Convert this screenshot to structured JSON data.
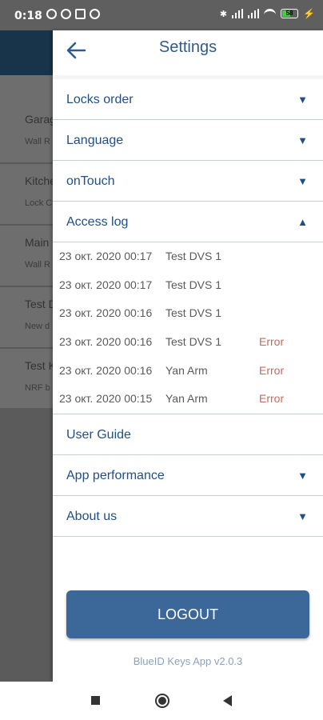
{
  "status_bar": {
    "time": "0:18",
    "battery_level": "58"
  },
  "background_app": {
    "items": [
      {
        "title": "Garage",
        "subtitle": "Wall R"
      },
      {
        "title": "Kitchen",
        "subtitle": "Lock C"
      },
      {
        "title": "Main",
        "subtitle": "Wall R"
      },
      {
        "title": "Test D",
        "subtitle": "New d"
      },
      {
        "title": "Test K",
        "subtitle": "NRF b"
      }
    ]
  },
  "drawer": {
    "title": "Settings",
    "menu": {
      "locks_order": "Locks order",
      "language": "Language",
      "on_touch": "onTouch",
      "access_log": "Access log",
      "user_guide": "User Guide",
      "app_performance": "App performance",
      "about_us": "About us"
    },
    "arrows": {
      "down": "▼",
      "up": "▲"
    },
    "access_log": [
      {
        "date": "23 окт. 2020 00:17",
        "device": "Test DVS 1",
        "status": ""
      },
      {
        "date": "23 окт. 2020 00:17",
        "device": "Test DVS 1",
        "status": ""
      },
      {
        "date": "23 окт. 2020 00:16",
        "device": "Test DVS 1",
        "status": ""
      },
      {
        "date": "23 окт. 2020 00:16",
        "device": "Test DVS 1",
        "status": "Error"
      },
      {
        "date": "23 окт. 2020 00:16",
        "device": "Yan Arm",
        "status": "Error"
      },
      {
        "date": "23 окт. 2020 00:15",
        "device": "Yan Arm",
        "status": "Error"
      }
    ],
    "logout_label": "LOGOUT",
    "version": "BlueID Keys App v2.0.3"
  },
  "colors": {
    "accent": "#1f4f86",
    "button": "#3b6899",
    "error": "#c46b61"
  }
}
